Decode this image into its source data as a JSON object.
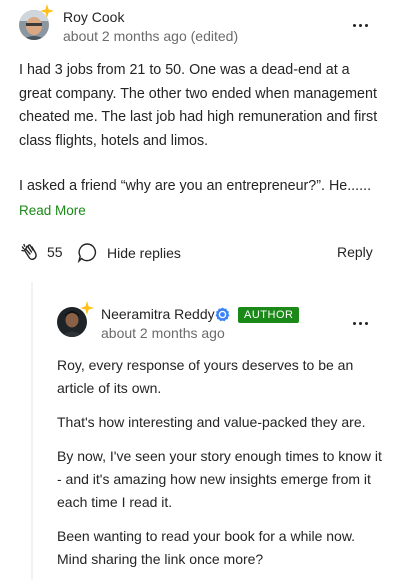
{
  "comment": {
    "author": "Roy Cook",
    "meta": "about 2 months ago (edited)",
    "text_p1": "I had 3 jobs from 21 to 50. One was a dead-end at a great company. The other two ended when management cheated me. The last job had high remuneration and first class flights, hotels and limos.",
    "text_p2": "I asked a friend “why are you an entrepreneur?”. He......",
    "read_more": "Read More",
    "clap_count": "55",
    "hide_replies": "Hide replies",
    "reply": "Reply"
  },
  "reply_comment": {
    "author": "Neeramitra Reddy",
    "badge": "AUTHOR",
    "meta": "about 2 months ago",
    "paragraphs": [
      "Roy, every response of yours deserves to be an article of its own.",
      "That's how interesting and value-packed they are.",
      "By now, I've seen your story enough times to know it - and it's amazing how new insights emerge from it each time I read it.",
      "Been wanting to read your book for a while now. Mind sharing the link once more?"
    ]
  },
  "colors": {
    "accent_green": "#1a8917",
    "verified_blue": "#3b82f6",
    "star_yellow": "#ffc017",
    "meta_gray": "#6b6b6b"
  },
  "icons": [
    "star-badge-icon",
    "more-options-icon",
    "clap-icon",
    "speech-bubble-icon",
    "verified-icon"
  ]
}
